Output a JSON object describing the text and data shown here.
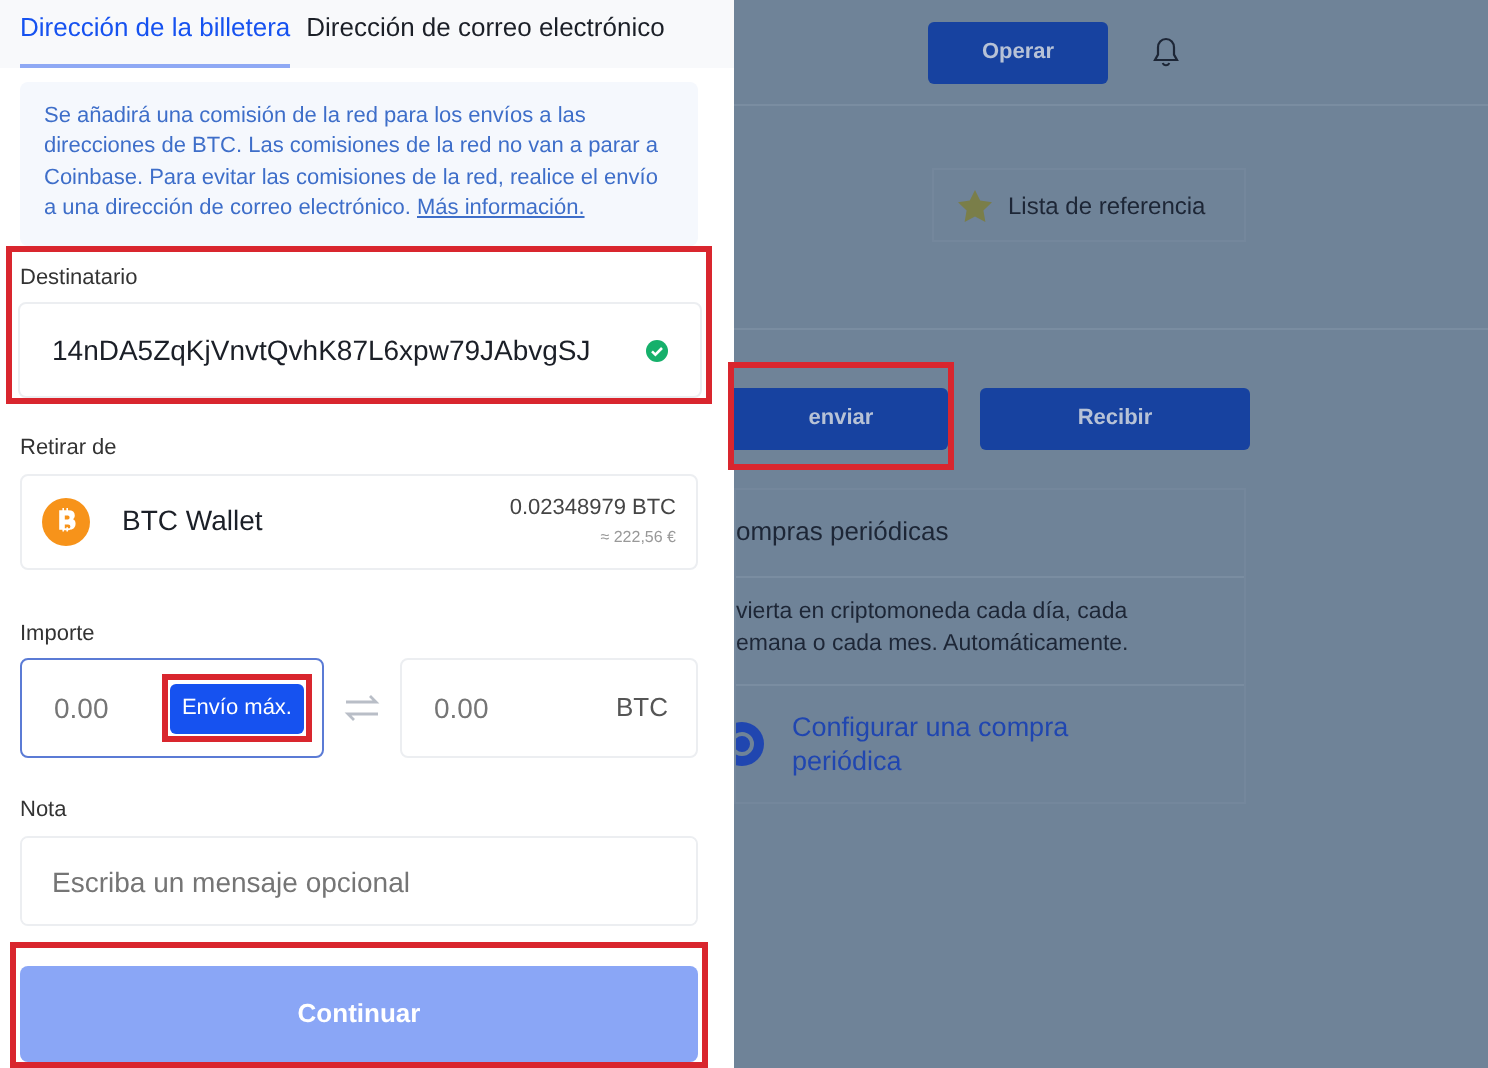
{
  "send_panel": {
    "tabs": [
      {
        "label": "Dirección de la billetera",
        "selected": true
      },
      {
        "label": "Dirección de correo electrónico",
        "selected": false
      }
    ],
    "notice": {
      "text": "Se añadirá una comisión de la red para los envíos a las direcciones de BTC. Las comisiones de la red no van a parar a Coinbase. Para evitar las comisiones de la red, realice el envío a una dirección de correo electrónico.",
      "link": "Más información."
    },
    "recipient": {
      "label": "Destinatario",
      "value": "14nDA5ZqKjVnvtQvhK87L6xpw79JAbvgSJ",
      "valid": true,
      "highlighted": true
    },
    "withdraw_from": {
      "label": "Retirar de",
      "wallet": "BTC Wallet",
      "balance": "0.02348979 BTC",
      "fiat": "≈ 222,56 €"
    },
    "amount": {
      "label": "Importe",
      "placeholder": "0.00",
      "max_button": "Envío máx.",
      "max_highlighted": true,
      "converted_placeholder": "0.00",
      "currency": "BTC"
    },
    "note": {
      "label": "Nota",
      "placeholder": "Escriba un mensaje opcional"
    },
    "continue_button": {
      "label": "Continuar",
      "disabled": true,
      "highlighted": true
    }
  },
  "background": {
    "trade_button": "Operar",
    "watchlist": "Lista de referencia",
    "actions": [
      {
        "label": "enviar",
        "highlighted": true
      },
      {
        "label": "Recibir",
        "highlighted": false
      }
    ],
    "recurring_card": {
      "title": "ompras periódicas",
      "text_lines": [
        "vierta en criptomoneda cada día, cada",
        "emana o cada mes. Automáticamente."
      ],
      "link": "Configurar una compra periódica"
    }
  }
}
